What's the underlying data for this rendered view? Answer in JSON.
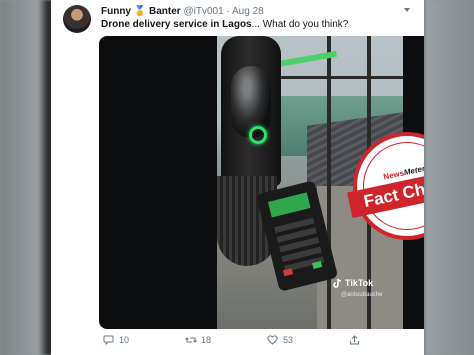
{
  "tweet": {
    "display_name": "Funny",
    "display_name_emoji": "🏅",
    "display_name_suffix": "Banter",
    "handle": "@iTv001",
    "separator": "·",
    "date": "Aug 28",
    "text_bold": "Drone delivery service in Lagos",
    "text_rest": "... What do you think?"
  },
  "media": {
    "tiktok_label": "TikTok",
    "tiktok_handle": "@anlsiubauche",
    "stamp_brand_prefix": "News",
    "stamp_brand_suffix": "Meter",
    "stamp_label": "Fact Check"
  },
  "actions": {
    "reply_count": "10",
    "retweet_count": "18",
    "like_count": "53",
    "share_icon": "share-icon"
  },
  "colors": {
    "text_primary": "#14171a",
    "text_secondary": "#657786",
    "stamp_red": "#d0242c",
    "drone_led": "#2ce36b"
  }
}
